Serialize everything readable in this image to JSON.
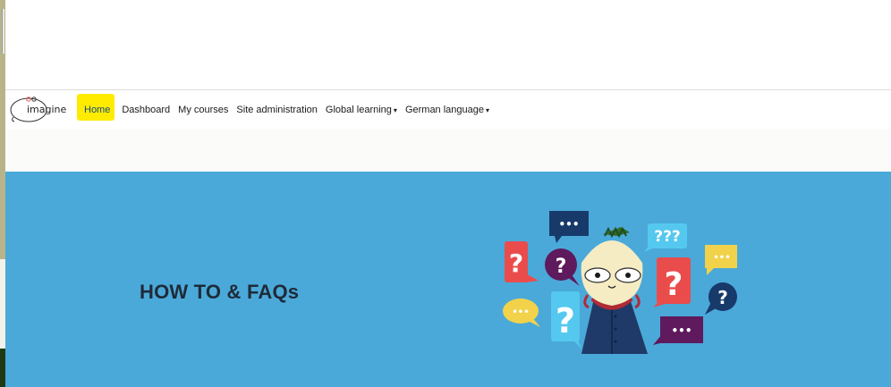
{
  "nav": {
    "brand": "imagine",
    "items": [
      {
        "label": "Home",
        "active": true
      },
      {
        "label": "Dashboard"
      },
      {
        "label": "My courses"
      },
      {
        "label": "Site administration"
      },
      {
        "label": "Global learning",
        "dropdown": true
      },
      {
        "label": "German language",
        "dropdown": true
      }
    ]
  },
  "hero": {
    "title": "HOW TO & FAQs",
    "background": "#4aa9d9",
    "bubbles": {
      "q1": "?",
      "q2": "?",
      "q3": "?",
      "q4": "?",
      "q5": "?",
      "qqq": "???",
      "dots": "•••"
    }
  },
  "colors": {
    "highlight": "#ffeb00",
    "nav_text": "#1a1a1a",
    "title": "#1f2a38"
  }
}
